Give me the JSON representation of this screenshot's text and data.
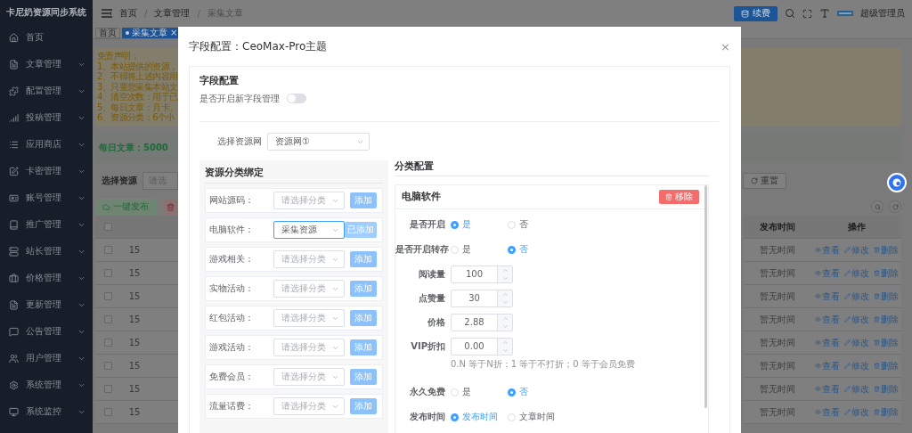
{
  "sidebar": {
    "title": "卡尼奶资源同步系统",
    "items": [
      {
        "label": "首页",
        "has_submenu": false
      },
      {
        "label": "文章管理",
        "has_submenu": true
      },
      {
        "label": "配置管理",
        "has_submenu": true
      },
      {
        "label": "投稿管理",
        "has_submenu": true
      },
      {
        "label": "应用商店",
        "has_submenu": true
      },
      {
        "label": "卡密管理",
        "has_submenu": true
      },
      {
        "label": "账号管理",
        "has_submenu": true
      },
      {
        "label": "推广管理",
        "has_submenu": true
      },
      {
        "label": "站长管理",
        "has_submenu": true
      },
      {
        "label": "价格管理",
        "has_submenu": true
      },
      {
        "label": "更新管理",
        "has_submenu": true
      },
      {
        "label": "公告管理",
        "has_submenu": true
      },
      {
        "label": "用户管理",
        "has_submenu": true
      },
      {
        "label": "系统管理",
        "has_submenu": true
      },
      {
        "label": "系统监控",
        "has_submenu": true
      }
    ]
  },
  "header": {
    "breadcrumb": [
      "首页",
      "文章管理",
      "采集文章"
    ],
    "separator": "/",
    "renew_button": "续费",
    "user": "超级管理员"
  },
  "tabs": [
    {
      "label": "首页",
      "selected": false
    },
    {
      "label": "采集文章",
      "selected": true,
      "close": "×"
    }
  ],
  "notice": {
    "lines": [
      "免责声明：",
      "1、本站提供的资源，",
      "2、不得将上述内容用",
      "3、只要您采集本站文",
      "4、清空次数：用于已",
      "5、每日文章：月卡、",
      "6、资源分类：6个小"
    ]
  },
  "stats": {
    "text": "每日文章：5000"
  },
  "filter": {
    "label": "选择资源",
    "placeholder": "请选",
    "reset_button": "重置"
  },
  "actions": {
    "publish_button": "一键发布"
  },
  "table": {
    "header_checked": false,
    "columns": [
      "发布时间",
      "操作"
    ],
    "rows": [
      {
        "checked": false,
        "column_1": "15",
        "time": "暂无时间",
        "actions": [
          "查看",
          "修改",
          "删除"
        ]
      },
      {
        "checked": false,
        "column_1": "15",
        "time": "暂无时间",
        "actions": [
          "查看",
          "修改",
          "删除"
        ]
      },
      {
        "checked": false,
        "column_1": "15",
        "time": "暂无时间",
        "actions": [
          "查看",
          "修改",
          "删除"
        ]
      },
      {
        "checked": false,
        "column_1": "15",
        "time": "暂无时间",
        "actions": [
          "查看",
          "修改",
          "删除"
        ]
      },
      {
        "checked": false,
        "column_1": "15",
        "time": "暂无时间",
        "actions": [
          "查看",
          "修改",
          "删除"
        ]
      },
      {
        "checked": false,
        "column_1": "15",
        "time": "暂无时间",
        "actions": [
          "查看",
          "修改",
          "删除"
        ]
      },
      {
        "checked": false,
        "column_1": "15",
        "time": "暂无时间",
        "actions": [
          "查看",
          "修改",
          "删除"
        ]
      },
      {
        "checked": false,
        "column_1": "15",
        "time": "暂无时间",
        "actions": [
          "查看",
          "修改",
          "删除"
        ]
      }
    ]
  },
  "modal": {
    "title": "字段配置：CeoMax-Pro主题",
    "close": "×",
    "section_title": "字段配置",
    "toggle": {
      "label": "是否开启新字段管理",
      "on": false
    },
    "source": {
      "label": "选择资源网",
      "value": "资源网①"
    },
    "binding": {
      "title": "资源分类绑定",
      "rows": [
        {
          "label": "网站源码：",
          "placeholder": "请选择分类",
          "button": "添加",
          "added": false
        },
        {
          "label": "电脑软件：",
          "value": "采集资源",
          "button": "已添加",
          "added": true
        },
        {
          "label": "游戏相关：",
          "placeholder": "请选择分类",
          "button": "添加",
          "added": false
        },
        {
          "label": "实物活动：",
          "placeholder": "请选择分类",
          "button": "添加",
          "added": false
        },
        {
          "label": "红包活动：",
          "placeholder": "请选择分类",
          "button": "添加",
          "added": false
        },
        {
          "label": "游戏活动：",
          "placeholder": "请选择分类",
          "button": "添加",
          "added": false
        },
        {
          "label": "免费会员：",
          "placeholder": "请选择分类",
          "button": "添加",
          "added": false
        },
        {
          "label": "流量话费：",
          "placeholder": "请选择分类",
          "button": "添加",
          "added": false
        }
      ]
    },
    "config": {
      "title": "分类配置",
      "card": {
        "title": "电脑软件",
        "remove_button": "移除",
        "fields": [
          {
            "kind": "radio",
            "label": "是否开启",
            "options": [
              {
                "label": "是",
                "selected": true
              },
              {
                "label": "否",
                "selected": false
              }
            ]
          },
          {
            "kind": "radio",
            "label": "是否开启转存",
            "options": [
              {
                "label": "是",
                "selected": false
              },
              {
                "label": "否",
                "selected": true
              }
            ]
          },
          {
            "kind": "number",
            "label": "阅读量",
            "value": "100"
          },
          {
            "kind": "number",
            "label": "点赞量",
            "value": "30"
          },
          {
            "kind": "number",
            "label": "价格",
            "value": "2.88"
          },
          {
            "kind": "number",
            "label": "VIP折扣",
            "value": "0.00",
            "hint": "0.N 等于N折；1 等于不打折；0 等于会员免费"
          },
          {
            "kind": "radio",
            "label": "永久免费",
            "options": [
              {
                "label": "是",
                "selected": false
              },
              {
                "label": "否",
                "selected": true
              }
            ]
          },
          {
            "kind": "radio",
            "label": "发布时间",
            "options": [
              {
                "label": "发布时间",
                "selected": true
              },
              {
                "label": "文章时间",
                "selected": false
              }
            ]
          }
        ]
      }
    }
  }
}
